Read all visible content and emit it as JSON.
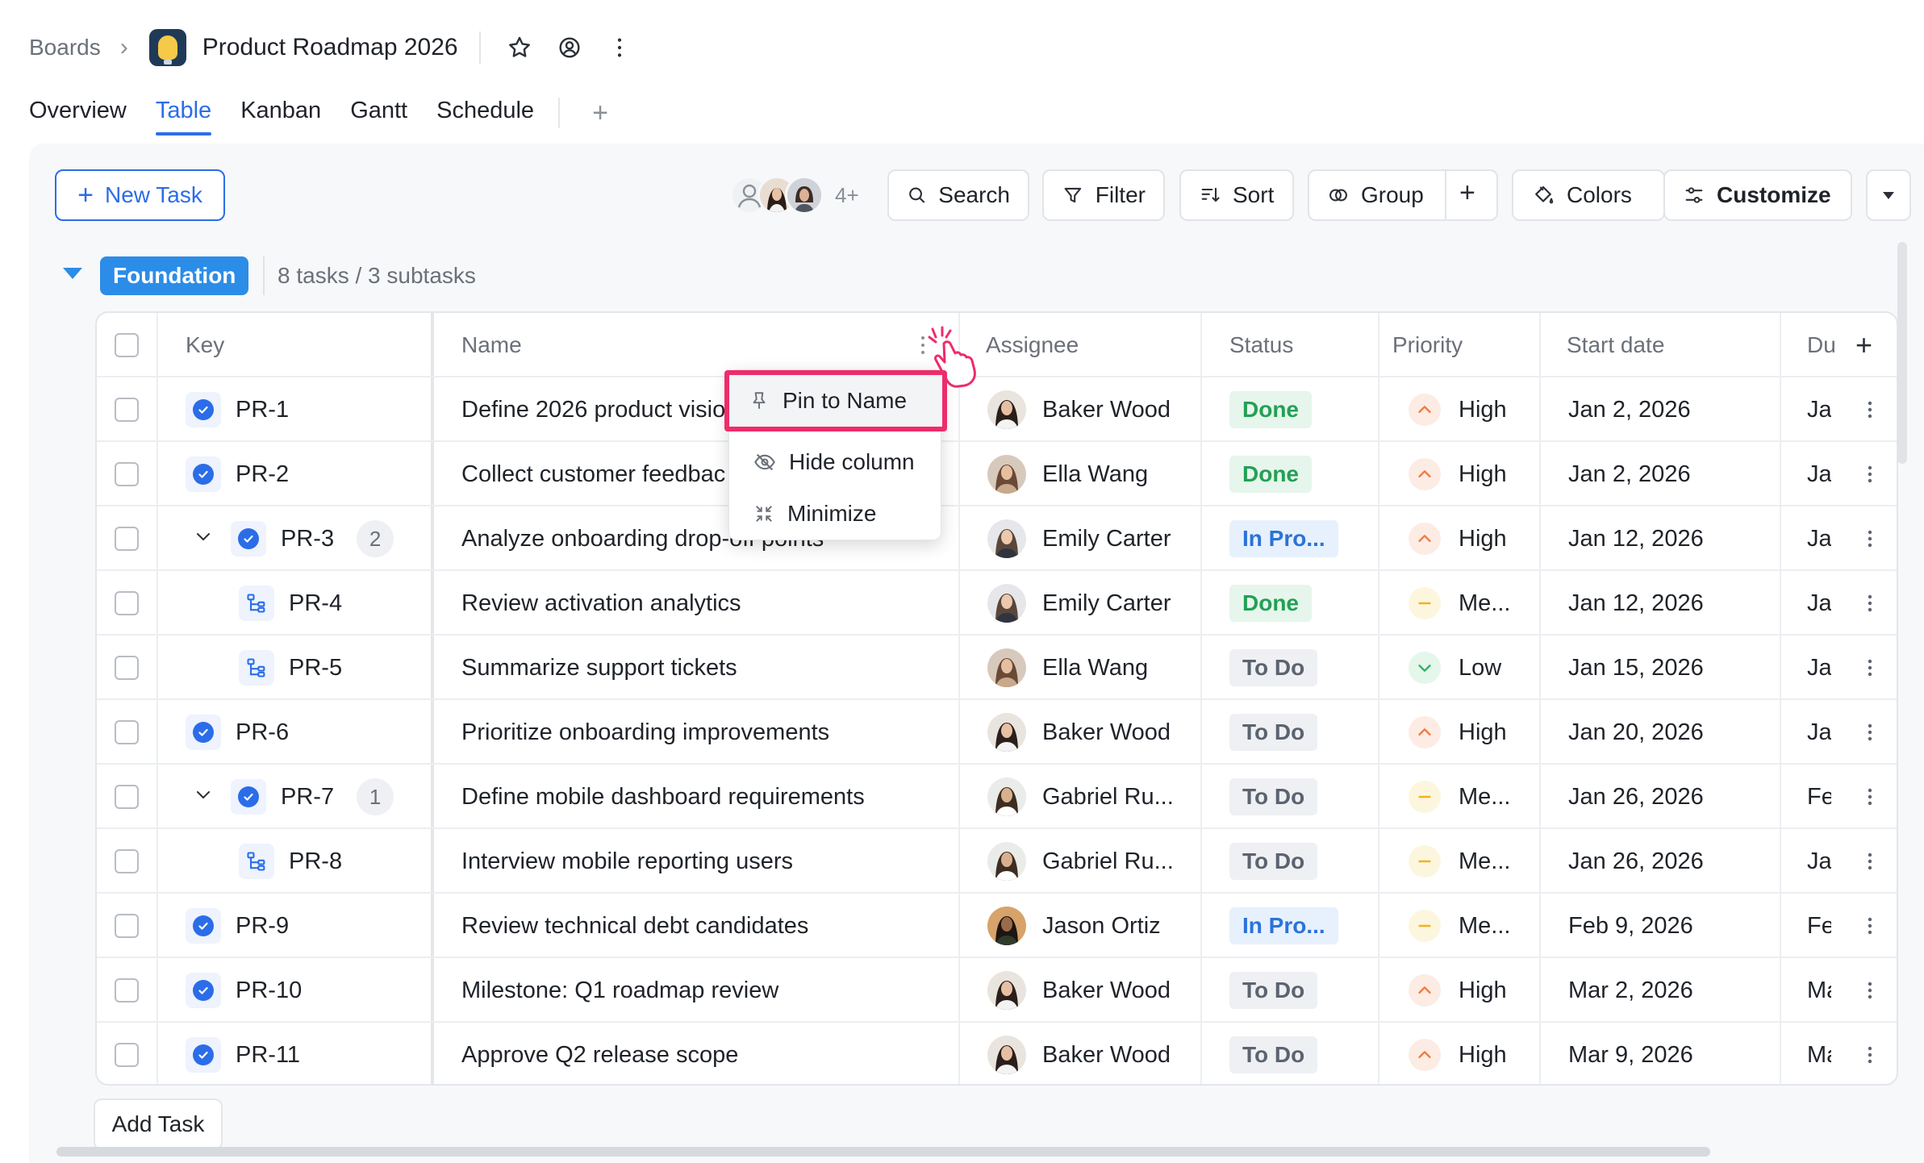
{
  "breadcrumb": {
    "root": "Boards",
    "board_title": "Product Roadmap 2026"
  },
  "tabs": [
    {
      "label": "Overview"
    },
    {
      "label": "Table"
    },
    {
      "label": "Kanban"
    },
    {
      "label": "Gantt"
    },
    {
      "label": "Schedule"
    }
  ],
  "toolbar": {
    "new_task": "New Task",
    "avatars_more": "4+",
    "search": "Search",
    "filter": "Filter",
    "sort": "Sort",
    "group": "Group",
    "colors": "Colors",
    "customize": "Customize"
  },
  "group": {
    "name": "Foundation",
    "count_text": "8 tasks / 3 subtasks"
  },
  "columns": {
    "key": "Key",
    "name": "Name",
    "assignee": "Assignee",
    "status": "Status",
    "priority": "Priority",
    "start_date": "Start date",
    "due": "Du"
  },
  "rows": [
    {
      "key": "PR-1",
      "name": "Define 2026 product visio",
      "assignee": "Baker Wood",
      "status": "Done",
      "priority": "High",
      "start": "Jan 2, 2026",
      "due": "Jar"
    },
    {
      "key": "PR-2",
      "name": "Collect customer feedbac",
      "assignee": "Ella Wang",
      "status": "Done",
      "priority": "High",
      "start": "Jan 2, 2026",
      "due": "Jar"
    },
    {
      "key": "PR-3",
      "sub_count": "2",
      "name": "Analyze onboarding drop-off points",
      "assignee": "Emily Carter",
      "status": "In Pro...",
      "priority": "High",
      "start": "Jan 12, 2026",
      "due": "Jar"
    },
    {
      "key": "PR-4",
      "name": "Review activation analytics",
      "assignee": "Emily Carter",
      "status": "Done",
      "priority": "Me...",
      "start": "Jan 12, 2026",
      "due": "Jar"
    },
    {
      "key": "PR-5",
      "name": "Summarize support tickets",
      "assignee": "Ella Wang",
      "status": "To Do",
      "priority": "Low",
      "start": "Jan 15, 2026",
      "due": "Jar"
    },
    {
      "key": "PR-6",
      "name": "Prioritize onboarding improvements",
      "assignee": "Baker Wood",
      "status": "To Do",
      "priority": "High",
      "start": "Jan 20, 2026",
      "due": "Jar"
    },
    {
      "key": "PR-7",
      "sub_count": "1",
      "name": "Define mobile dashboard requirements",
      "assignee": "Gabriel Ru...",
      "status": "To Do",
      "priority": "Me...",
      "start": "Jan 26, 2026",
      "due": "Fe"
    },
    {
      "key": "PR-8",
      "name": "Interview mobile reporting users",
      "assignee": "Gabriel Ru...",
      "status": "To Do",
      "priority": "Me...",
      "start": "Jan 26, 2026",
      "due": "Jar"
    },
    {
      "key": "PR-9",
      "name": "Review technical debt candidates",
      "assignee": "Jason Ortiz",
      "status": "In Pro...",
      "priority": "Me...",
      "start": "Feb 9, 2026",
      "due": "Fe"
    },
    {
      "key": "PR-10",
      "name": "Milestone: Q1 roadmap review",
      "assignee": "Baker Wood",
      "status": "To Do",
      "priority": "High",
      "start": "Mar 2, 2026",
      "due": "Ma"
    },
    {
      "key": "PR-11",
      "name": "Approve Q2 release scope",
      "assignee": "Baker Wood",
      "status": "To Do",
      "priority": "High",
      "start": "Mar 9, 2026",
      "due": "Ma"
    }
  ],
  "context_menu": {
    "pin": "Pin to Name",
    "hide": "Hide column",
    "minimize": "Minimize"
  },
  "add_task": "Add Task",
  "colors": {
    "accent": "#2b6de8",
    "group": "#2b8de8",
    "highlight": "#ee2c6a",
    "done": "#23a055",
    "in_progress": "#2b73d8"
  }
}
